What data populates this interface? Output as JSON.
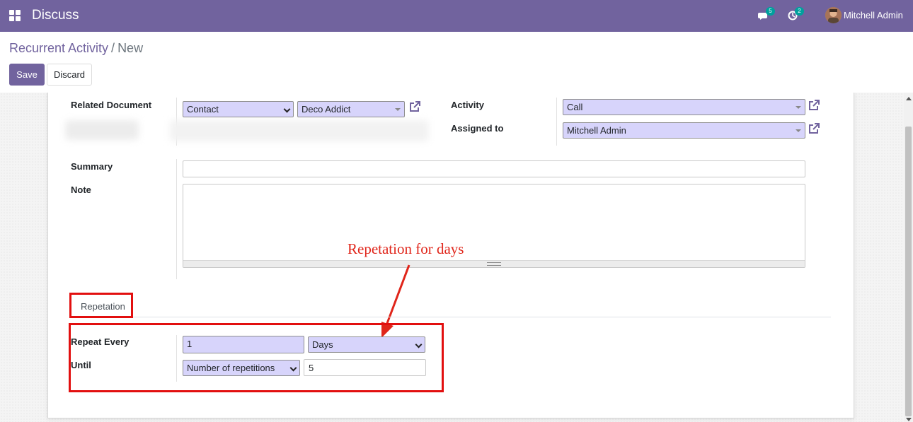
{
  "topbar": {
    "app_title": "Discuss",
    "messages_badge": "5",
    "activities_badge": "2",
    "user_name": "Mitchell Admin",
    "color": "#71639e"
  },
  "breadcrumb": {
    "parent": "Recurrent Activity",
    "separator": "/",
    "current": "New"
  },
  "buttons": {
    "save": "Save",
    "discard": "Discard"
  },
  "form": {
    "related_document_label": "Related Document",
    "related_model": "Contact",
    "related_record": "Deco Addict",
    "activity_label": "Activity",
    "activity_value": "Call",
    "assigned_to_label": "Assigned to",
    "assigned_to_value": "Mitchell Admin",
    "summary_label": "Summary",
    "summary_value": "",
    "note_label": "Note",
    "note_value": ""
  },
  "tabs": [
    {
      "label": "Repetation"
    }
  ],
  "repetition": {
    "repeat_every_label": "Repeat Every",
    "repeat_every_value": "1",
    "repeat_unit": "Days",
    "until_label": "Until",
    "until_type": "Number of repetitions",
    "until_count": "5"
  },
  "annotation": {
    "text": "Repetation for days",
    "color": "#e0251a"
  }
}
